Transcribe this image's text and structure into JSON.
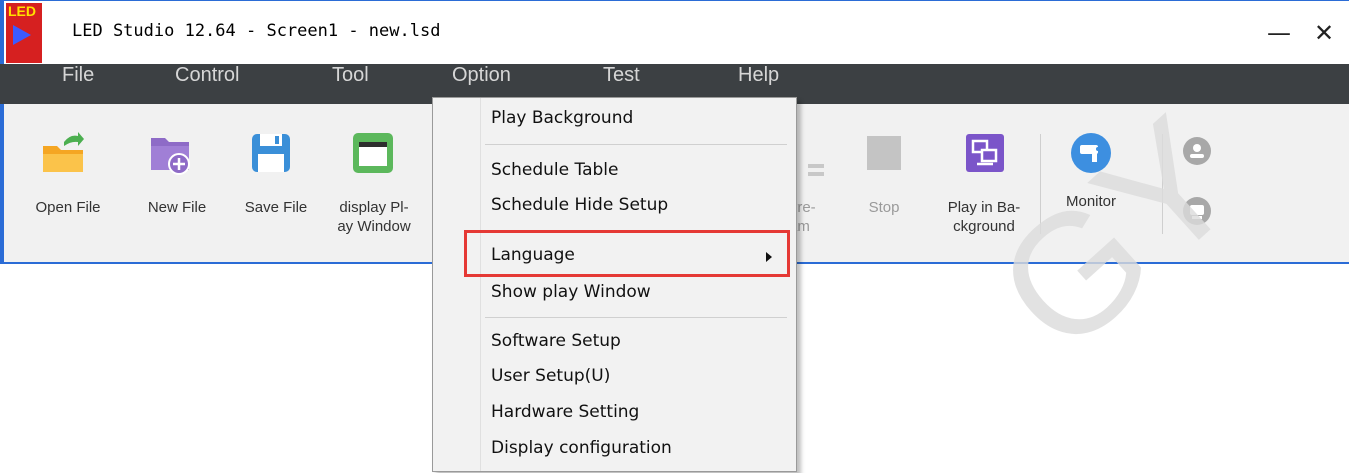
{
  "window": {
    "logo_text": "LED",
    "title": "LED Studio 12.64 - Screen1 - new.lsd",
    "minimize": "—",
    "close": "✕"
  },
  "menubar": {
    "items": [
      {
        "label": "File"
      },
      {
        "label": "Control"
      },
      {
        "label": "Tool"
      },
      {
        "label": "Option"
      },
      {
        "label": "Test"
      },
      {
        "label": "Help"
      }
    ]
  },
  "toolbar": {
    "tools": [
      {
        "label": "Open File",
        "icon": "open-folder-icon",
        "enabled": true
      },
      {
        "label": "New File",
        "icon": "new-file-icon",
        "enabled": true
      },
      {
        "label": "Save File",
        "icon": "save-icon",
        "enabled": true
      },
      {
        "label": "display Pl-\nay Window",
        "icon": "window-icon",
        "enabled": true
      },
      {
        "label": "urre-\nram",
        "icon": "program-icon",
        "enabled": false
      },
      {
        "label": "Stop",
        "icon": "stop-icon",
        "enabled": false
      },
      {
        "label": "Play in Ba-\nckground",
        "icon": "play-background-icon",
        "enabled": true
      },
      {
        "label": "Monitor",
        "icon": "monitor-icon",
        "enabled": true
      }
    ]
  },
  "option_menu": {
    "items": [
      {
        "label": "Play Background"
      },
      {
        "label": "Schedule Table"
      },
      {
        "label": "Schedule Hide Setup"
      },
      {
        "label": "Language",
        "has_submenu": true,
        "highlighted": true
      },
      {
        "label": "Show play Window"
      },
      {
        "label": "Software Setup"
      },
      {
        "label": "User Setup(U)"
      },
      {
        "label": "Hardware Setting"
      },
      {
        "label": "Display configuration"
      }
    ]
  },
  "watermark": "GY",
  "colors": {
    "menubar_bg": "#3c4043",
    "window_border": "#2b6cd6",
    "highlight": "#e53935"
  }
}
